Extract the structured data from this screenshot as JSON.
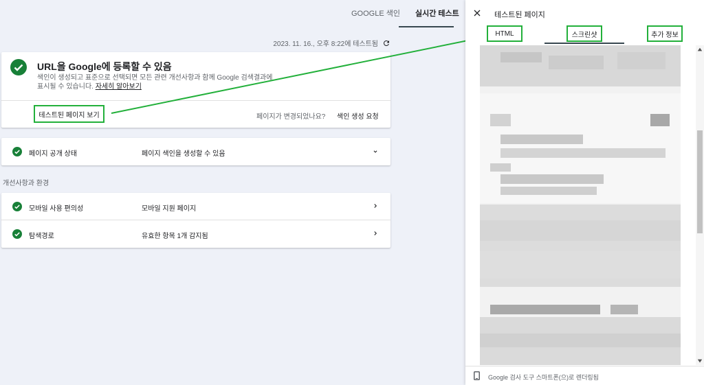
{
  "top_tabs": [
    {
      "label": "GOOGLE 색인",
      "active": false
    },
    {
      "label": "실시간 테스트",
      "active": true
    }
  ],
  "timestamp": "2023. 11. 16., 오후 8:22에 테스트됨",
  "main": {
    "title_bold1": "URL을 Google",
    "title_rest": "에 등록할 수 있음",
    "desc": "색인이 생성되고 표준으로 선택되면 모든 관련 개선사항과 함께 Google 검색결과에 표시될 수 있습니다. ",
    "learn_more": "자세히 알아보기",
    "view_tested_page": "테스트된 페이지 보기",
    "page_changed": "페이지가 변경되었나요?",
    "request_indexing": "색인 생성 요청"
  },
  "page_availability": {
    "label": "페이지 공개 상태",
    "value": "페이지 색인을 생성할 수 있음"
  },
  "enhancements": {
    "title": "개선사항과 환경",
    "items": [
      {
        "label": "모바일 사용 편의성",
        "value": "모바일 지원 페이지"
      },
      {
        "label": "탐색경로",
        "value": "유효한 항목 1개 감지됨"
      }
    ]
  },
  "panel": {
    "title": "테스트된 페이지",
    "tabs": [
      {
        "label": "HTML"
      },
      {
        "label": "스크린샷",
        "active": true
      },
      {
        "label": "추가 정보"
      }
    ],
    "footer": "Google 검사 도구 스마트폰(으)로 렌더링됨"
  },
  "colors": {
    "success": "#188038",
    "highlight": "#22b03a",
    "accent": "#1a73e8"
  }
}
